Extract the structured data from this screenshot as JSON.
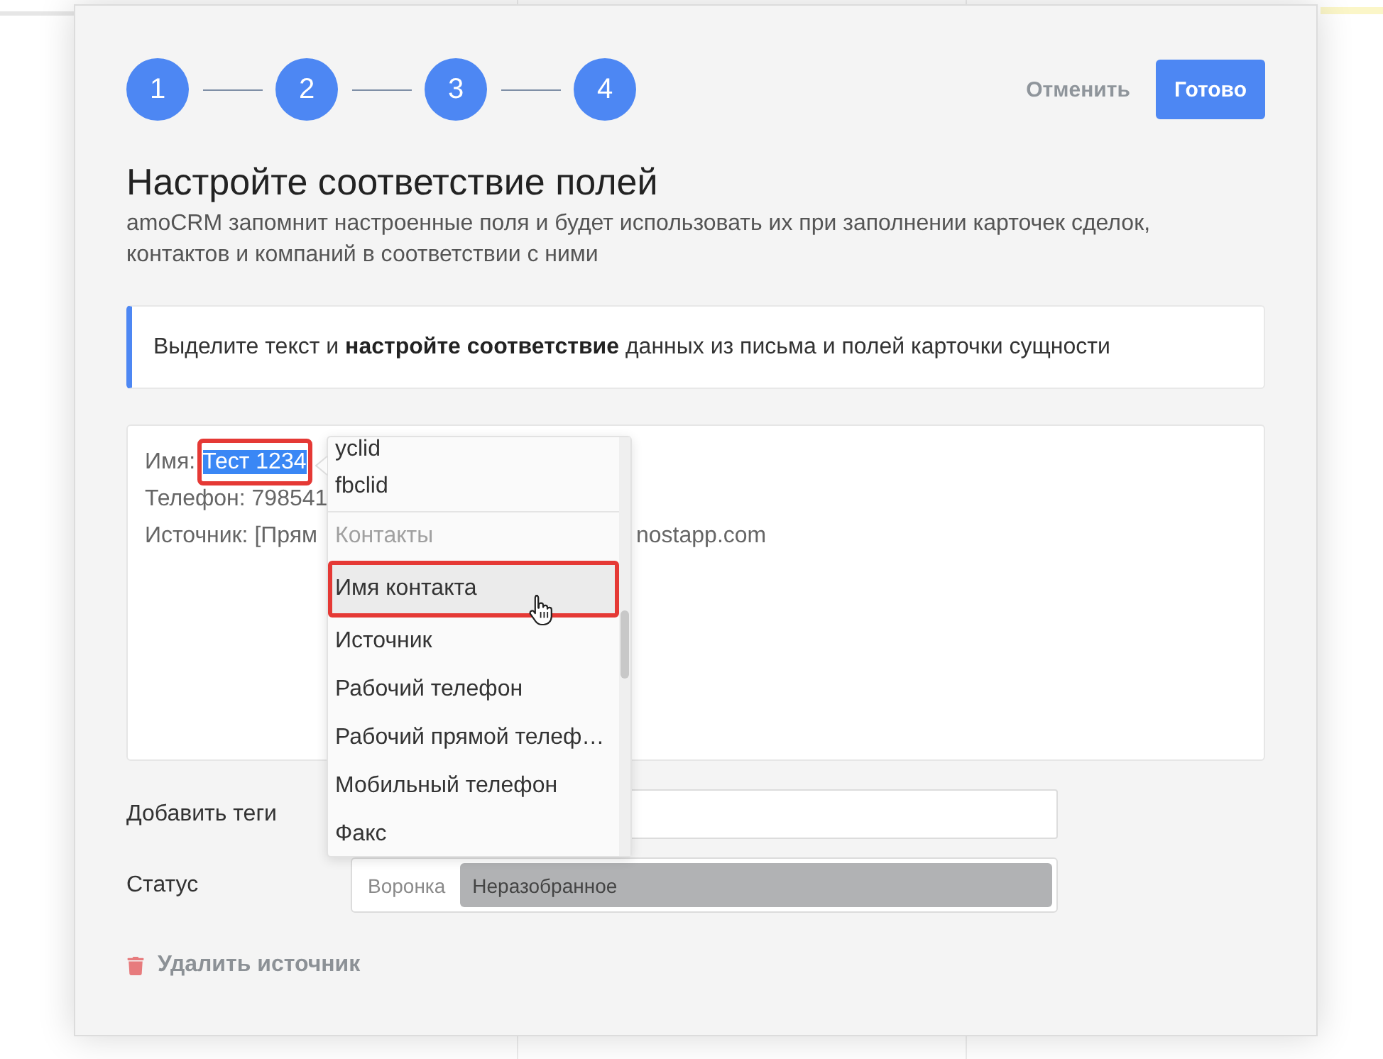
{
  "stepper": {
    "steps": [
      "1",
      "2",
      "3",
      "4"
    ]
  },
  "header_actions": {
    "cancel": "Отменить",
    "done": "Готово"
  },
  "title": "Настройте соответствие полей",
  "subtitle": "amoCRM запомнит настроенные поля и будет использовать их при заполнении карточек сделок, контактов и компаний в соответствии с ними",
  "hint": "Выделите текст и **настройте соответствие** данных из письма и полей карточки сущности",
  "email_text": {
    "lines": [
      {
        "segments": [
          {
            "text": "Имя:",
            "selected": false,
            "annotated": false
          },
          {
            "text": "Тест 1234",
            "selected": true,
            "annotated": true
          }
        ]
      },
      {
        "segments": [
          {
            "text": "Телефон: 798541",
            "selected": false,
            "annotated": false
          }
        ]
      },
      {
        "segments": [
          {
            "text": "Источник: [Прям",
            "selected": false,
            "annotated": false
          }
        ],
        "after_popup": "nostapp.com"
      }
    ]
  },
  "field_menu": {
    "items": [
      {
        "kind": "option",
        "label": "yclid",
        "hovered": false,
        "annotated": false
      },
      {
        "kind": "option",
        "label": "fbclid",
        "hovered": false,
        "annotated": false
      },
      {
        "kind": "group",
        "label": "Контакты"
      },
      {
        "kind": "option",
        "label": "Имя контакта",
        "hovered": true,
        "annotated": true
      },
      {
        "kind": "option",
        "label": "Источник",
        "hovered": false,
        "annotated": false
      },
      {
        "kind": "option",
        "label": "Рабочий телефон",
        "hovered": false,
        "annotated": false
      },
      {
        "kind": "option",
        "label": "Рабочий прямой телеф…",
        "hovered": false,
        "annotated": false
      },
      {
        "kind": "option",
        "label": "Мобильный телефон",
        "hovered": false,
        "annotated": false
      },
      {
        "kind": "option",
        "label": "Факс",
        "hovered": false,
        "annotated": false
      }
    ]
  },
  "tags": {
    "label": "Добавить теги"
  },
  "status": {
    "label": "Статус",
    "pipeline": "Воронка",
    "stage": "Неразобранное"
  },
  "delete_link": "Удалить источник"
}
